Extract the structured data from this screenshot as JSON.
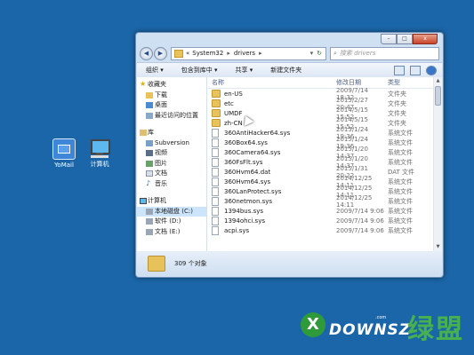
{
  "desktop": {
    "icons": [
      {
        "label": "YoMail"
      },
      {
        "label": "计算机"
      }
    ]
  },
  "window": {
    "address": [
      "«",
      "System32",
      "drivers"
    ],
    "search_placeholder": "搜索 drivers",
    "controls": {
      "minimize": "–",
      "maximize": "□",
      "close": "x"
    },
    "toolbar": {
      "organize": "组织 ▾",
      "include": "包含到库中 ▾",
      "share": "共享 ▾",
      "new_folder": "新建文件夹"
    },
    "nav": {
      "favorites": {
        "label": "收藏夹",
        "items": [
          "下载",
          "桌面",
          "最近访问的位置"
        ]
      },
      "libraries": {
        "label": "库",
        "items": [
          "Subversion",
          "视频",
          "图片",
          "文档",
          "音乐"
        ]
      },
      "computer": {
        "label": "计算机",
        "items": [
          "本地磁盘 (C:)",
          "软件 (D:)",
          "文档 (E:)"
        ]
      }
    },
    "columns": {
      "name": "名称",
      "date": "修改日期",
      "type": "类型"
    },
    "files": [
      {
        "name": "en-US",
        "date": "2009/7/14 18:32",
        "type": "文件夹",
        "kind": "folder"
      },
      {
        "name": "etc",
        "date": "2015/2/27 20:47",
        "type": "文件夹",
        "kind": "folder"
      },
      {
        "name": "UMDF",
        "date": "2014/5/15 15:52",
        "type": "文件夹",
        "kind": "folder"
      },
      {
        "name": "zh-CN",
        "date": "2014/5/15 15:52",
        "type": "文件夹",
        "kind": "folder"
      },
      {
        "name": "360AntiHacker64.sys",
        "date": "2015/1/24 19:36",
        "type": "系统文件",
        "kind": "file"
      },
      {
        "name": "360Box64.sys",
        "date": "2015/1/24 19:36",
        "type": "系统文件",
        "kind": "file"
      },
      {
        "name": "360Camera64.sys",
        "date": "2015/1/20 14:37",
        "type": "系统文件",
        "kind": "file"
      },
      {
        "name": "360FsFlt.sys",
        "date": "2015/1/20 14:37",
        "type": "系统文件",
        "kind": "file"
      },
      {
        "name": "360Hvm64.dat",
        "date": "2015/1/31 20:22",
        "type": "DAT 文件",
        "kind": "dat"
      },
      {
        "name": "360Hvm64.sys",
        "date": "2014/12/25 14:11",
        "type": "系统文件",
        "kind": "file"
      },
      {
        "name": "360LanProtect.sys",
        "date": "2014/12/25 14:11",
        "type": "系统文件",
        "kind": "file"
      },
      {
        "name": "360netmon.sys",
        "date": "2014/12/25 14:11",
        "type": "系统文件",
        "kind": "file"
      },
      {
        "name": "1394bus.sys",
        "date": "2009/7/14 9:06",
        "type": "系统文件",
        "kind": "file"
      },
      {
        "name": "1394ohci.sys",
        "date": "2009/7/14 9:06",
        "type": "系统文件",
        "kind": "file"
      },
      {
        "name": "acpi.sys",
        "date": "2009/7/14 9:06",
        "type": "系统文件",
        "kind": "file"
      }
    ],
    "status": "309 个对象"
  },
  "watermark": {
    "mark": "X",
    "text": "DOWNSZ",
    "com": ".com",
    "cn": "绿盟"
  },
  "colors": {
    "desktop": "#1b66a8",
    "window_frame": "#cfe0f3",
    "selection": "#cde5fb",
    "folder": "#e8c25a"
  }
}
